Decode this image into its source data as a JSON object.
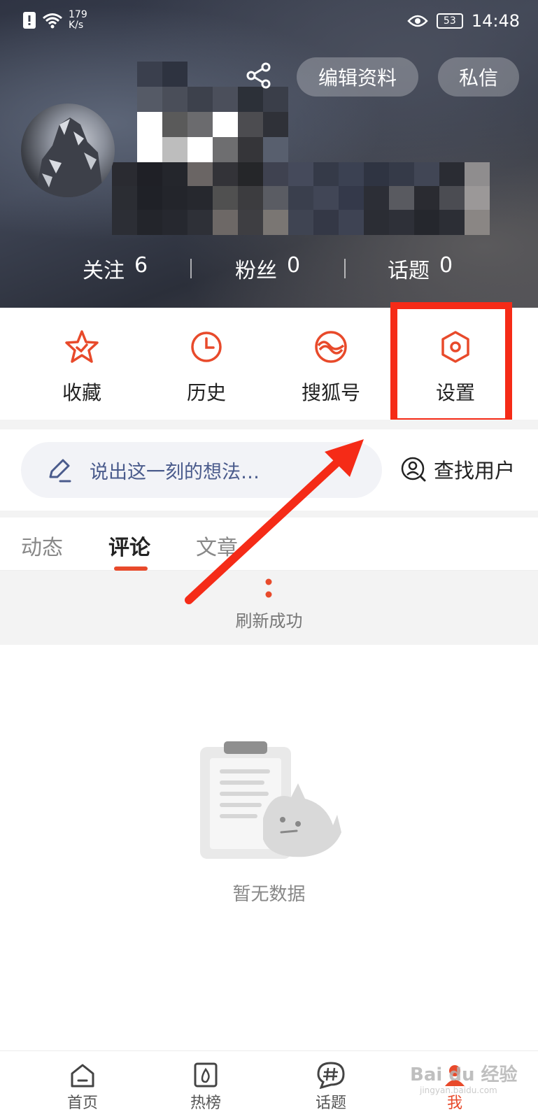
{
  "status_bar": {
    "net_speed_value": "179",
    "net_speed_unit": "K/s",
    "battery": "53",
    "time": "14:48"
  },
  "profile": {
    "edit_button": "编辑资料",
    "message_button": "私信",
    "stats": [
      {
        "label": "关注",
        "value": "6"
      },
      {
        "label": "粉丝",
        "value": "0"
      },
      {
        "label": "话题",
        "value": "0"
      }
    ]
  },
  "actions": [
    {
      "label": "收藏",
      "icon": "star-icon"
    },
    {
      "label": "历史",
      "icon": "clock-icon"
    },
    {
      "label": "搜狐号",
      "icon": "sohu-icon"
    },
    {
      "label": "设置",
      "icon": "settings-hexagon-icon"
    }
  ],
  "compose": {
    "placeholder": "说出这一刻的想法…",
    "find_user": "查找用户"
  },
  "tabs": [
    {
      "label": "动态",
      "active": false
    },
    {
      "label": "评论",
      "active": true
    },
    {
      "label": "文章",
      "active": false
    }
  ],
  "refresh": {
    "text": "刷新成功"
  },
  "empty": {
    "text": "暂无数据"
  },
  "bottom_nav": [
    {
      "label": "首页",
      "icon": "home-icon",
      "active": false
    },
    {
      "label": "热榜",
      "icon": "hot-list-icon",
      "active": false
    },
    {
      "label": "话题",
      "icon": "topic-icon",
      "active": false
    },
    {
      "label": "我",
      "icon": "me-icon",
      "active": true
    }
  ],
  "watermark": {
    "text": "Bai du 经验",
    "sub": "jingyan.baidu.com"
  },
  "colors": {
    "accent": "#e84a2b",
    "highlight": "#f52b17",
    "compose_text": "#4a5b8c"
  }
}
